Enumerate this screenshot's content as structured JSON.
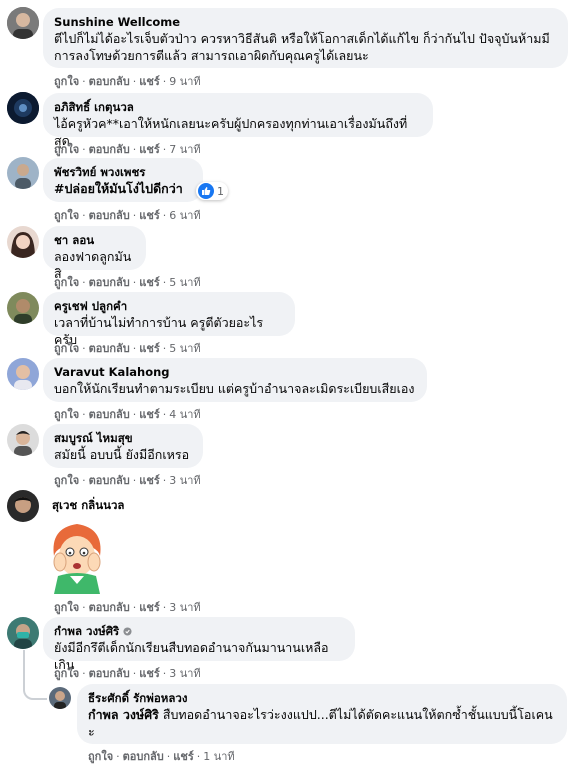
{
  "actions": {
    "like": "ถูกใจ",
    "reply": "ตอบกลับ",
    "share": "แชร์",
    "dot": "·"
  },
  "comments": [
    {
      "author": "Sunshine Wellcome",
      "text": "ตีไปก็ไม่ได้อะไรเจ็บตัวป่าว ควรหาวิธีสันติ หรือให้โอกาสเด็กได้แก้ไข ก็ว่ากันไป ปัจจุบันห้ามมีการลงโทษด้วยการตีแล้ว สามารถเอาผิดกับคุณครูได้เลยนะ",
      "time": "9 นาที"
    },
    {
      "author": "อภิสิทธิ์ เกตุนวล",
      "text": "ไอ้ครูหัวค**เอาให้หนักเลยนะครับผู้ปกครองทุกท่านเอาเรื่องมันถึงที่สุด",
      "time": "7 นาที"
    },
    {
      "author": "พัชรวิทย์ พวงเพชร",
      "text": "#ปล่อยให้มันโง่ไปดีกว่า",
      "time": "6 นาที",
      "reaction_count": "1"
    },
    {
      "author": "ชา ลอน",
      "text": "ลองฟาดลูกมันสิ",
      "time": "5 นาที"
    },
    {
      "author": "ครูเชฟ ปลูกคำ",
      "text": "เวลาที่บ้านไม่ทำการบ้าน ครูตีตัวยอะไรครับ",
      "time": "5 นาที"
    },
    {
      "author": "Varavut Kalahong",
      "text": "บอกให้นักเรียนทำตามระเบียบ แต่ครูบ้าอำนาจละเมิดระเบียบเสียเอง",
      "time": "4 นาที"
    },
    {
      "author": "สมบูรณ์ ไหมสุข",
      "text": "สมัยนี้ อบบนี้ ยังมีอีกเหรอ",
      "time": "3 นาที"
    },
    {
      "author": "สุเวช กลิ่นนวล",
      "time": "3 นาที"
    },
    {
      "author": "กำพล วงษ์ศิริ",
      "text": "ยังมีอีกรึตีเด็กนักเรียนสืบทอดอำนาจกันมานานเหลือเกิน",
      "time": "3 นาที"
    }
  ],
  "reply": {
    "author": "ธีระศักดิ์ รักพ่อหลวง",
    "mention": "กำพล วงษ์ศิริ",
    "text": " สืบทอดอำนาจอะไรว่ะงงแปป...ตีไม่ได้ตัดคะแนนให้ตกซ้ำชั้นแบบนี้โอเคนะ",
    "time": "1 นาที"
  },
  "colors": {
    "bubble": "#f0f2f5",
    "meta": "#65676b",
    "like_blue": "#1877f2",
    "text": "#050505"
  }
}
